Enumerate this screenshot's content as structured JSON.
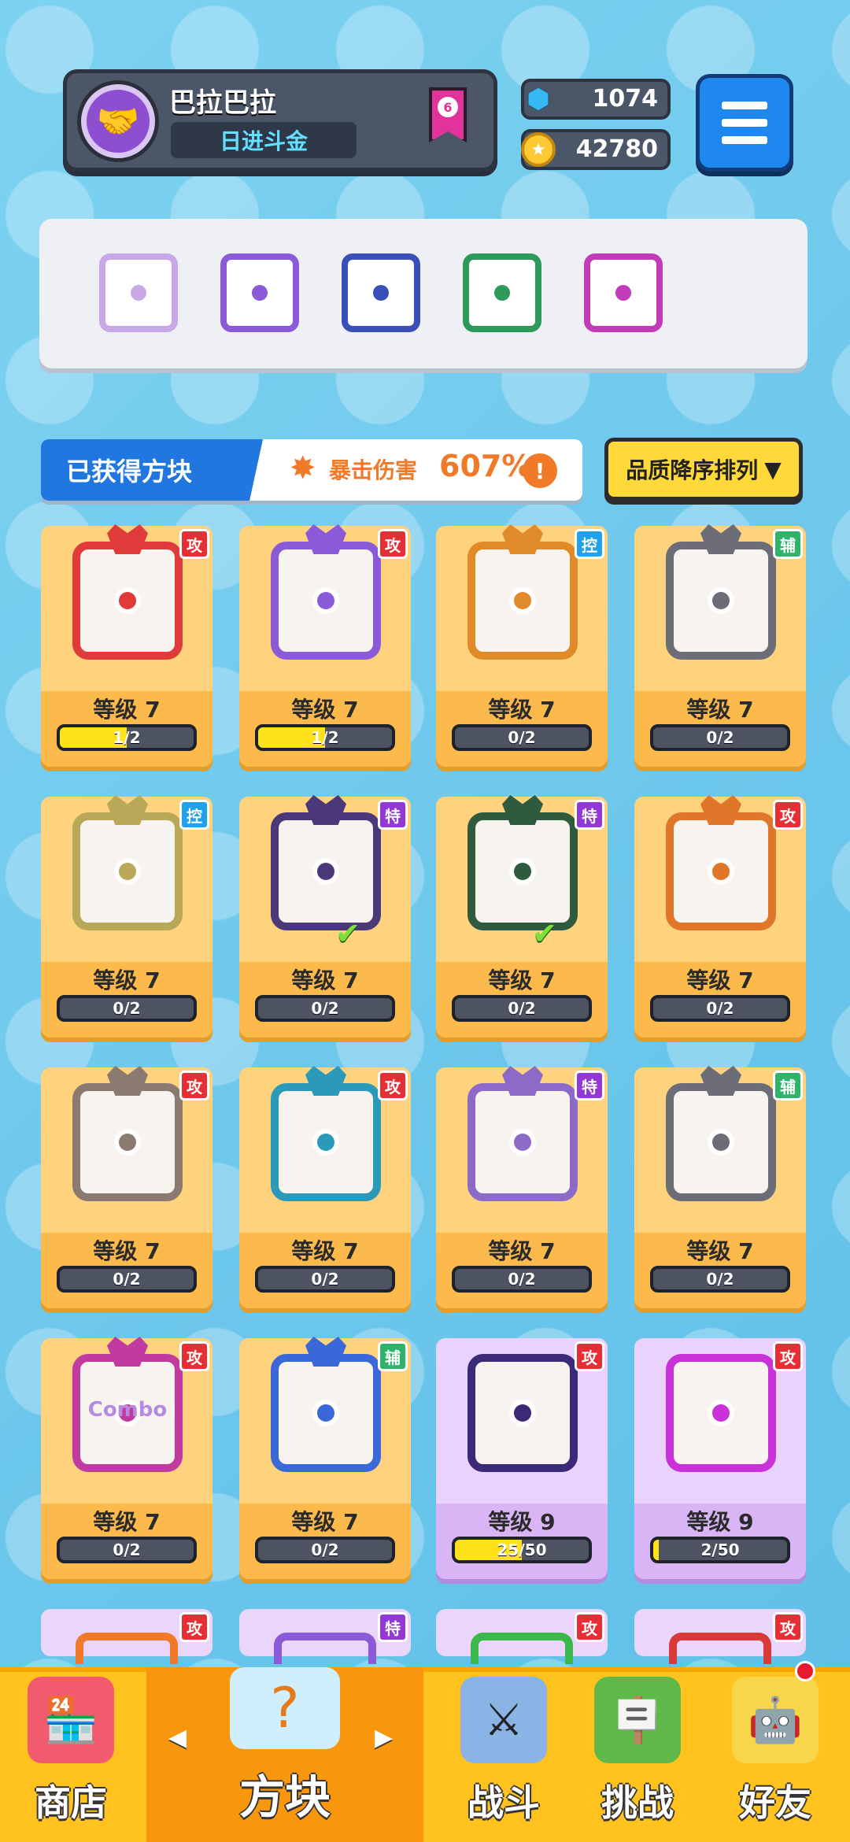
{
  "profile": {
    "name": "巴拉巴拉",
    "title": "日进斗金",
    "rank": "6"
  },
  "currency": {
    "gems": "1074",
    "coins": "42780"
  },
  "deck_slots": [
    {
      "color": "#c9a8e8"
    },
    {
      "color": "#8b5ad8"
    },
    {
      "color": "#3a4fb8"
    },
    {
      "color": "#2d9a5a"
    },
    {
      "color": "#c23bb8"
    }
  ],
  "section": {
    "title": "已获得方块",
    "crit_label": "暴击伤害",
    "crit_value": "607%",
    "info_icon": "!",
    "sort_label": "品质降序排列"
  },
  "cards": [
    {
      "tag": "攻",
      "tag_type": "atk",
      "color": "#e03a3a",
      "level": "等级 7",
      "progress": "1/2",
      "fill": 0.5
    },
    {
      "tag": "攻",
      "tag_type": "atk",
      "color": "#8b5ad8",
      "level": "等级 7",
      "progress": "1/2",
      "fill": 0.5
    },
    {
      "tag": "控",
      "tag_type": "ctl",
      "color": "#e08a2a",
      "level": "等级 7",
      "progress": "0/2",
      "fill": 0
    },
    {
      "tag": "辅",
      "tag_type": "sup",
      "color": "#6d6d78",
      "level": "等级 7",
      "progress": "0/2",
      "fill": 0
    },
    {
      "tag": "控",
      "tag_type": "ctl",
      "color": "#b8a858",
      "level": "等级 7",
      "progress": "0/2",
      "fill": 0
    },
    {
      "tag": "特",
      "tag_type": "spc",
      "color": "#4a3878",
      "level": "等级 7",
      "progress": "0/2",
      "fill": 0,
      "check": "✔"
    },
    {
      "tag": "特",
      "tag_type": "spc",
      "color": "#2f5a3e",
      "level": "等级 7",
      "progress": "0/2",
      "fill": 0,
      "check": "✔"
    },
    {
      "tag": "攻",
      "tag_type": "atk",
      "color": "#e0762a",
      "level": "等级 7",
      "progress": "0/2",
      "fill": 0
    },
    {
      "tag": "攻",
      "tag_type": "atk",
      "color": "#8a7a70",
      "level": "等级 7",
      "progress": "0/2",
      "fill": 0
    },
    {
      "tag": "攻",
      "tag_type": "atk",
      "color": "#2a9ab8",
      "level": "等级 7",
      "progress": "0/2",
      "fill": 0
    },
    {
      "tag": "特",
      "tag_type": "spc",
      "color": "#8e6ac8",
      "level": "等级 7",
      "progress": "0/2",
      "fill": 0
    },
    {
      "tag": "辅",
      "tag_type": "sup",
      "color": "#6d6d78",
      "level": "等级 7",
      "progress": "0/2",
      "fill": 0
    },
    {
      "tag": "攻",
      "tag_type": "atk",
      "color": "#c03aa0",
      "level": "等级 7",
      "progress": "0/2",
      "fill": 0,
      "art_text": "Combo"
    },
    {
      "tag": "辅",
      "tag_type": "sup",
      "color": "#3a68d8",
      "level": "等级 7",
      "progress": "0/2",
      "fill": 0
    },
    {
      "tag": "攻",
      "tag_type": "atk",
      "color": "#3a2a78",
      "level": "等级 9",
      "progress": "25/50",
      "fill": 0.5,
      "style": "purple"
    },
    {
      "tag": "攻",
      "tag_type": "atk",
      "color": "#c832d8",
      "level": "等级 9",
      "progress": "2/50",
      "fill": 0.04,
      "style": "purple"
    }
  ],
  "cards_partial": [
    {
      "tag": "攻",
      "tag_type": "atk",
      "color": "#f07a2a"
    },
    {
      "tag": "特",
      "tag_type": "spc",
      "color": "#8b5ad8"
    },
    {
      "tag": "攻",
      "tag_type": "atk",
      "color": "#3ab84a"
    },
    {
      "tag": "攻",
      "tag_type": "atk",
      "color": "#d83a3a"
    }
  ],
  "nav": {
    "shop": "商店",
    "blocks": "方块",
    "battle": "战斗",
    "challenge": "挑战",
    "friends": "好友",
    "left_arrow": "◀",
    "right_arrow": "▶"
  },
  "icons": {
    "avatar": "handshake-icon",
    "gem": "gem-icon",
    "coin": "star-coin-icon",
    "menu": "hamburger-menu-icon",
    "crit": "burst-icon",
    "sort": "caret-down-icon"
  }
}
